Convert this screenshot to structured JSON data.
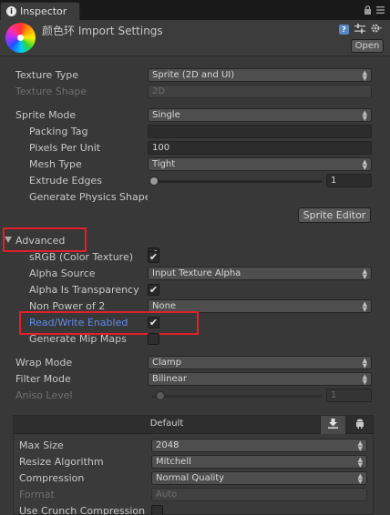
{
  "window": {
    "tab_label": "Inspector",
    "tab_icon": "info-icon"
  },
  "header": {
    "title": "颜色环 Import Settings",
    "open_label": "Open",
    "icons": [
      "help-icon",
      "preset-icon",
      "gear-icon"
    ]
  },
  "fields": {
    "texture_type": {
      "label": "Texture Type",
      "value": "Sprite (2D and UI)"
    },
    "texture_shape": {
      "label": "Texture Shape",
      "value": "2D"
    },
    "sprite_mode": {
      "label": "Sprite Mode",
      "value": "Single"
    },
    "packing_tag": {
      "label": "Packing Tag",
      "value": ""
    },
    "pixels_per_unit": {
      "label": "Pixels Per Unit",
      "value": "100"
    },
    "mesh_type": {
      "label": "Mesh Type",
      "value": "Tight"
    },
    "extrude_edges": {
      "label": "Extrude Edges",
      "value": "1",
      "level": 0.0
    },
    "generate_physics_shape": {
      "label": "Generate Physics Shape",
      "checked": true
    },
    "sprite_editor": {
      "label": "Sprite Editor"
    }
  },
  "advanced": {
    "label": "Advanced",
    "srgb": {
      "label": "sRGB (Color Texture)",
      "checked": true
    },
    "alpha_source": {
      "label": "Alpha Source",
      "value": "Input Texture Alpha"
    },
    "alpha_is_transparency": {
      "label": "Alpha Is Transparency",
      "checked": true
    },
    "non_power_of_2": {
      "label": "Non Power of 2",
      "value": "None"
    },
    "read_write": {
      "label": "Read/Write Enabled",
      "checked": true
    },
    "mip_maps": {
      "label": "Generate Mip Maps",
      "checked": false
    }
  },
  "wrap": {
    "wrap_mode": {
      "label": "Wrap Mode",
      "value": "Clamp"
    },
    "filter_mode": {
      "label": "Filter Mode",
      "value": "Bilinear"
    },
    "aniso_level": {
      "label": "Aniso Level",
      "value": "1",
      "level": 0.0
    }
  },
  "platform": {
    "title": "Default",
    "tabs": [
      "download-icon",
      "android-icon"
    ],
    "max_size": {
      "label": "Max Size",
      "value": "2048"
    },
    "resize_algorithm": {
      "label": "Resize Algorithm",
      "value": "Mitchell"
    },
    "compression": {
      "label": "Compression",
      "value": "Normal Quality"
    },
    "format": {
      "label": "Format",
      "value": "Auto"
    },
    "use_crunch": {
      "label": "Use Crunch Compression",
      "checked": false
    }
  },
  "colors": {
    "background": "#383838",
    "highlight_text": "#5d8cf0",
    "annotation_box": "#e0202a"
  }
}
